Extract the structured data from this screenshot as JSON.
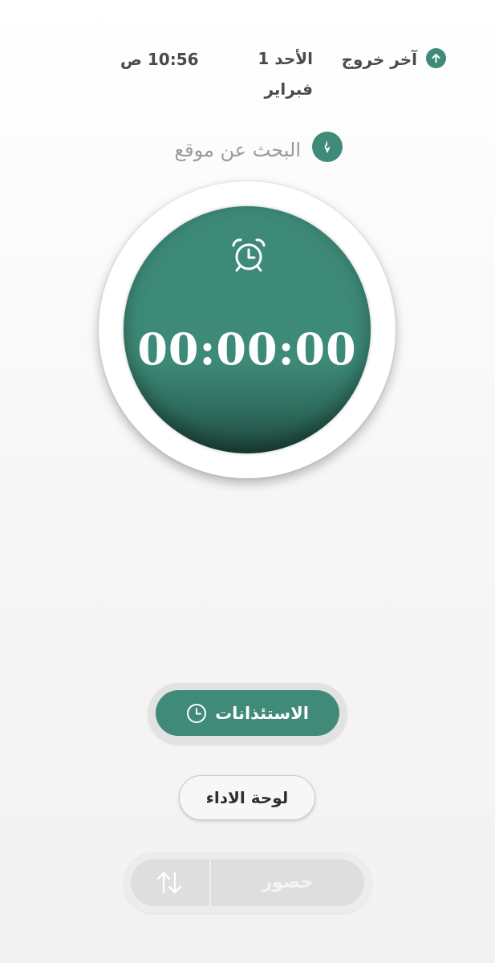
{
  "header": {
    "icon": "arrow-up-circle-icon",
    "last_checkout_label": "آخر خروج",
    "date": "الأحد 1 فبراير",
    "time": "10:56 ص"
  },
  "location": {
    "icon": "compass-icon",
    "search_label": "البحث عن موقع"
  },
  "timer": {
    "icon": "alarm-clock-icon",
    "value": "00:00:00"
  },
  "buttons": {
    "permissions": {
      "label": "الاستئذانات",
      "icon": "clock-icon"
    },
    "performance_dashboard": {
      "label": "لوحة الاداء"
    },
    "attendance": {
      "label": "حضور",
      "icon": "swap-vertical-icon",
      "state": "disabled"
    }
  },
  "colors": {
    "accent": "#3f8a78",
    "accent_dark": "#1f4a40",
    "muted_text": "#9a9a9a",
    "disabled_button": "#dedede"
  }
}
